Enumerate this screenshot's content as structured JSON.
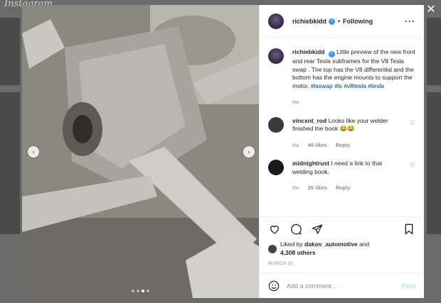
{
  "background": {
    "logo_text": "Instagram"
  },
  "post": {
    "username": "richiebkidd",
    "follow_status": "Following",
    "caption": {
      "username": "richiebkidd",
      "text": "Little preview of the new front and rear Tesla subframes for the V8 Tesla swap . The top has the V8 differential and the bottom has the engine mounts to support the motor.",
      "hashtags": "#lsswap #ls #v8tesla #tesla",
      "age": "6w"
    },
    "comments": [
      {
        "username": "vincxnt_rod",
        "text": "Looks like your welder finished the book 😂😂",
        "age": "6w",
        "likes": "49 likes",
        "reply": "Reply"
      },
      {
        "username": "midnightrust",
        "text": "I need a link to that welding book.",
        "age": "6w",
        "likes": "26 likes",
        "reply": "Reply"
      }
    ],
    "liked_by": {
      "prefix": "Liked by",
      "user": "dakov_automotive",
      "and": "and",
      "others": "4,308 others"
    },
    "date": "MARCH 31",
    "add_comment_placeholder": "Add a comment...",
    "post_label": "Post"
  },
  "colors": {
    "link": "#00376b",
    "verified": "#3897f0",
    "post_disabled": "#b2dffc"
  }
}
